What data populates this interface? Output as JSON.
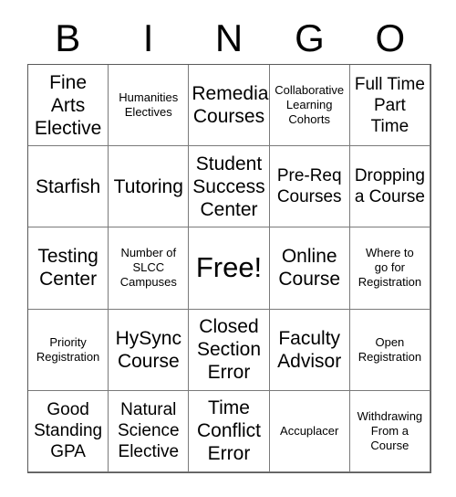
{
  "card": {
    "header_letters": [
      "B",
      "I",
      "N",
      "G",
      "O"
    ],
    "rows": [
      [
        {
          "text": "Fine\nArts\nElective",
          "size": "lg"
        },
        {
          "text": "Humanities\nElectives",
          "size": "sm"
        },
        {
          "text": "Remedial\nCourses",
          "size": "lg"
        },
        {
          "text": "Collaborative\nLearning\nCohorts",
          "size": "sm"
        },
        {
          "text": "Full Time\nPart\nTime",
          "size": "md"
        }
      ],
      [
        {
          "text": "Starfish",
          "size": "lg"
        },
        {
          "text": "Tutoring",
          "size": "lg"
        },
        {
          "text": "Student\nSuccess\nCenter",
          "size": "lg"
        },
        {
          "text": "Pre-Req\nCourses",
          "size": "md"
        },
        {
          "text": "Dropping\na Course",
          "size": "md"
        }
      ],
      [
        {
          "text": "Testing\nCenter",
          "size": "lg"
        },
        {
          "text": "Number of\nSLCC\nCampuses",
          "size": "sm"
        },
        {
          "text": "Free!",
          "size": "free"
        },
        {
          "text": "Online\nCourse",
          "size": "lg"
        },
        {
          "text": "Where to\ngo for\nRegistration",
          "size": "sm"
        }
      ],
      [
        {
          "text": "Priority\nRegistration",
          "size": "sm"
        },
        {
          "text": "HySync\nCourse",
          "size": "lg"
        },
        {
          "text": "Closed\nSection\nError",
          "size": "lg"
        },
        {
          "text": "Faculty\nAdvisor",
          "size": "lg"
        },
        {
          "text": "Open\nRegistration",
          "size": "sm"
        }
      ],
      [
        {
          "text": "Good\nStanding\nGPA",
          "size": "md"
        },
        {
          "text": "Natural\nScience\nElective",
          "size": "md"
        },
        {
          "text": "Time\nConflict\nError",
          "size": "lg"
        },
        {
          "text": "Accuplacer",
          "size": "sm"
        },
        {
          "text": "Withdrawing\nFrom a\nCourse",
          "size": "sm"
        }
      ]
    ],
    "colors": {
      "background": "#ffffff",
      "grid_line": "#7a7a7a",
      "outer_border": "#5a5a5a",
      "text": "#000000"
    }
  }
}
